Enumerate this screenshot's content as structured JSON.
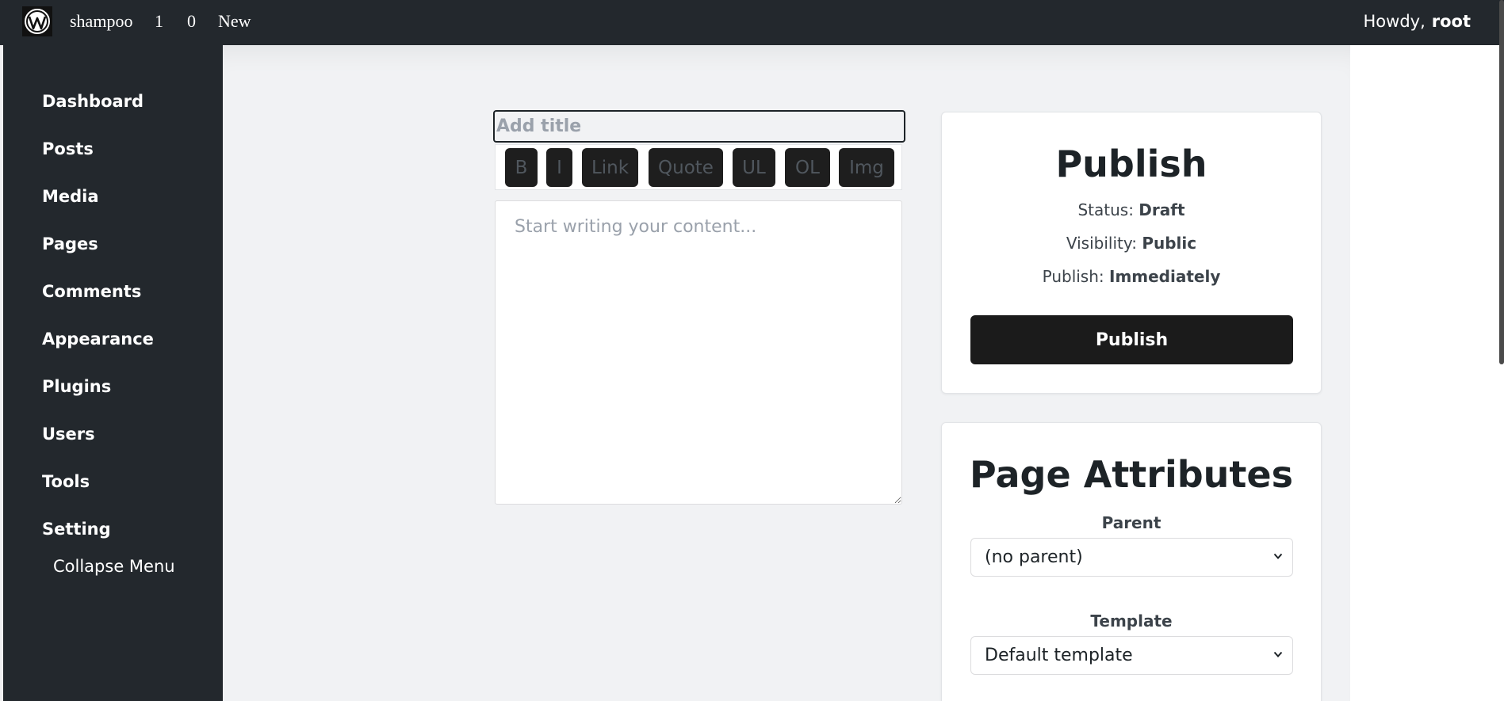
{
  "adminbar": {
    "site_name": "shampoo",
    "updates_count": "1",
    "comments_count": "0",
    "new_label": "New",
    "howdy_label": "Howdy,",
    "user_name": "root"
  },
  "sidebar": {
    "items": [
      {
        "label": "Dashboard"
      },
      {
        "label": "Posts"
      },
      {
        "label": "Media"
      },
      {
        "label": "Pages"
      },
      {
        "label": "Comments"
      },
      {
        "label": "Appearance"
      },
      {
        "label": "Plugins"
      },
      {
        "label": "Users"
      },
      {
        "label": "Tools"
      },
      {
        "label": "Setting"
      }
    ],
    "collapse_label": "Collapse Menu"
  },
  "editor": {
    "title_placeholder": "Add title",
    "title_value": "",
    "content_placeholder": "Start writing your content...",
    "toolbar": {
      "bold": "B",
      "italic": "I",
      "link": "Link",
      "quote": "Quote",
      "ul": "UL",
      "ol": "OL",
      "img": "Img"
    }
  },
  "publish": {
    "title": "Publish",
    "status_label": "Status:",
    "status_value": "Draft",
    "visibility_label": "Visibility:",
    "visibility_value": "Public",
    "schedule_label": "Publish:",
    "schedule_value": "Immediately",
    "button_label": "Publish"
  },
  "page_attributes": {
    "title": "Page Attributes",
    "parent_label": "Parent",
    "parent_value": "(no parent)",
    "template_label": "Template",
    "template_value": "Default template"
  },
  "colors": {
    "adminbar_bg": "#23282d",
    "button_dark": "#1b1b1b",
    "main_bg": "#f1f2f4"
  }
}
